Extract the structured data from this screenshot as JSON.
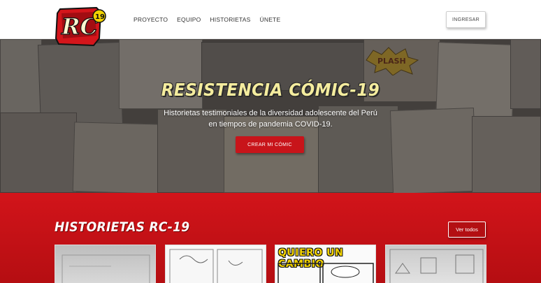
{
  "header": {
    "logo_text": "RC",
    "logo_badge": "19",
    "nav": [
      "PROYECTO",
      "EQUIPO",
      "HISTORIETAS",
      "ÚNETE"
    ],
    "login_label": "INGRESAR"
  },
  "hero": {
    "title": "RESISTENCIA CÓMIC-19",
    "subtitle_line1": "Historietas testimoniales de la diversidad adolescente del Perú",
    "subtitle_line2": "en tiempos de pandemia COVID-19.",
    "cta_label": "CREAR MI CÓMIC",
    "collage_word": "PLASH"
  },
  "comics": {
    "title": "HISTORIETAS RC-19",
    "see_all_label": "Ver todos",
    "cards": [
      {
        "title": ""
      },
      {
        "title": ""
      },
      {
        "title": "QUIERO UN CAMBIO"
      },
      {
        "title": ""
      }
    ]
  },
  "colors": {
    "brand_red": "#c8141a",
    "title_yellow": "#f4ec9e"
  }
}
